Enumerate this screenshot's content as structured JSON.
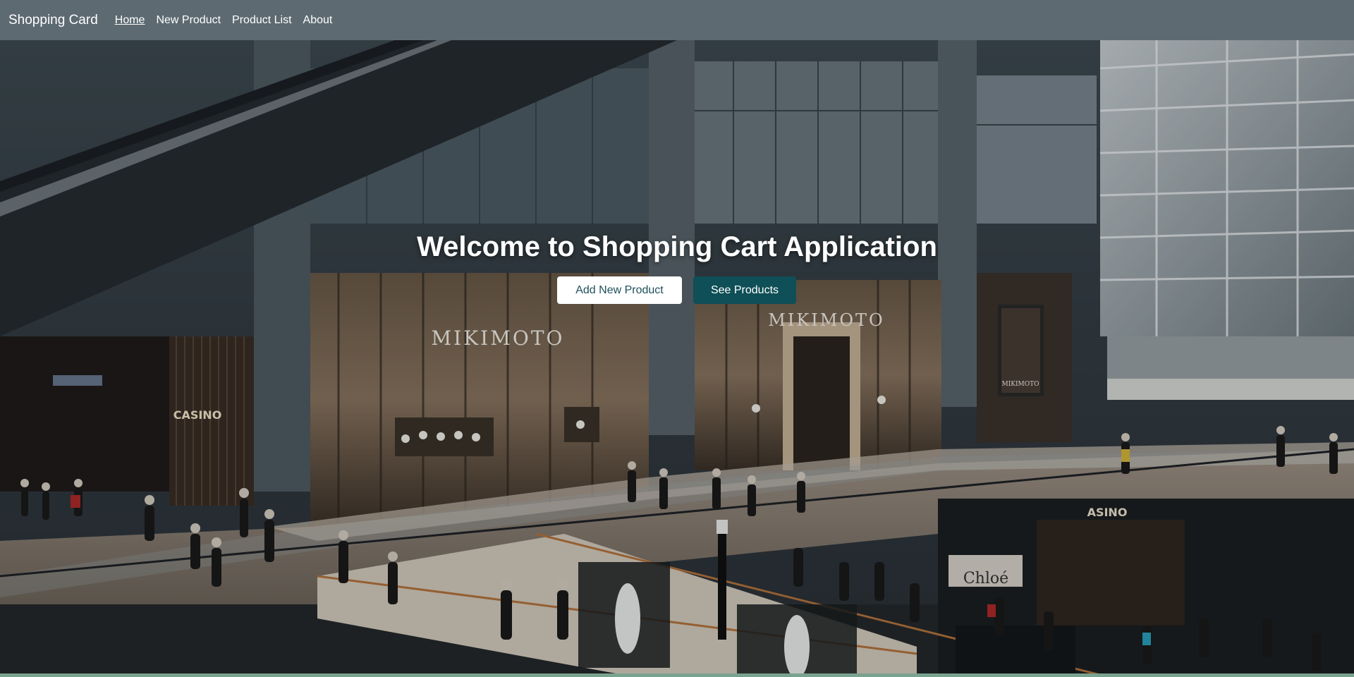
{
  "navbar": {
    "brand": "Shopping Card",
    "links": [
      {
        "label": "Home",
        "active": true
      },
      {
        "label": "New Product",
        "active": false
      },
      {
        "label": "Product List",
        "active": false
      },
      {
        "label": "About",
        "active": false
      }
    ]
  },
  "hero": {
    "title": "Welcome to Shopping Cart Application",
    "primary_button": "Add New Product",
    "secondary_button": "See Products",
    "background_signs": {
      "store_left": "MIKIMOTO",
      "store_right": "MIKIMOTO",
      "poster": "MIKIMOTO",
      "casino_left": "CASINO",
      "casino_right": "ASINO",
      "boutique": "Chloé"
    }
  },
  "colors": {
    "navbar": "#5d6a72",
    "primary_button_bg": "#ffffff",
    "secondary_button_bg": "#0f4f57"
  }
}
